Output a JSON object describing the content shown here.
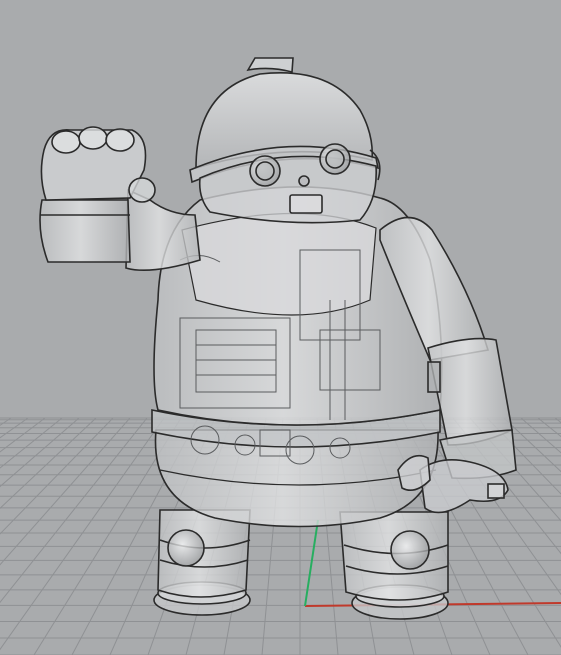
{
  "viewport": {
    "view": "perspective",
    "display_mode": "ghosted",
    "grid": true,
    "world_axes": [
      "x-axis",
      "y-axis"
    ]
  },
  "scene": {
    "model": "robot",
    "parts": [
      "helmet",
      "eyes",
      "nose",
      "mouth",
      "torso",
      "raised-arm",
      "fist",
      "lowered-arm",
      "hand",
      "legs",
      "knee-joints",
      "feet",
      "internal-mechanism"
    ]
  },
  "colors": {
    "background": "#a9abad",
    "grid_line": "#8f9194",
    "x_axis": "#c0392b",
    "y_axis": "#27ae60",
    "model_fill": "#cfd1d3",
    "model_edge": "#2b2b2b",
    "internal_edge": "#5a5c5e"
  }
}
